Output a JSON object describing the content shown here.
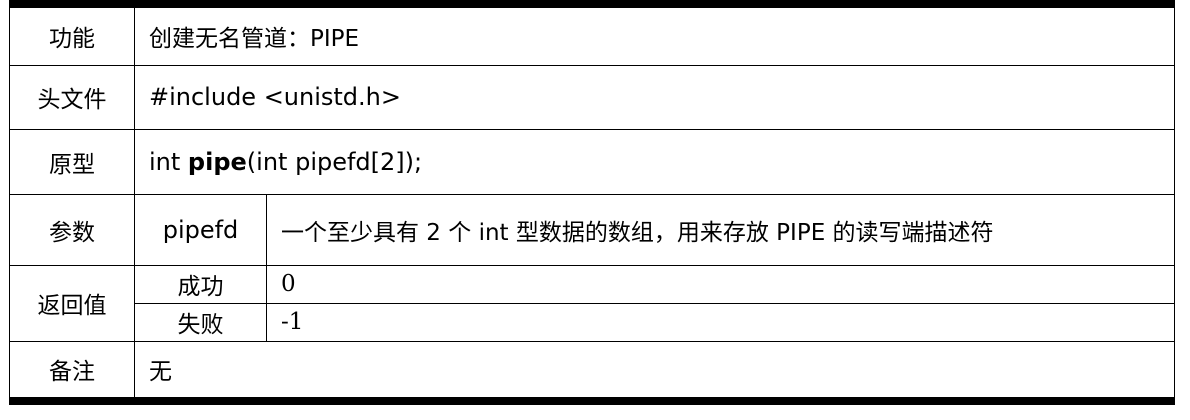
{
  "table": {
    "function": {
      "label": "功能",
      "value": "创建无名管道：PIPE"
    },
    "header_file": {
      "label": "头文件",
      "value": "#include <unistd.h>"
    },
    "prototype": {
      "label": "原型",
      "prefix": "int ",
      "name": "pipe",
      "suffix": "(int pipefd[2]);"
    },
    "params": {
      "label": "参数",
      "name": "pipefd",
      "description": "一个至少具有 2 个 int 型数据的数组，用来存放 PIPE 的读写端描述符"
    },
    "return_value": {
      "label": "返回值",
      "success_label": "成功",
      "success_value": "0",
      "failure_label": "失败",
      "failure_value": "-1"
    },
    "notes": {
      "label": "备注",
      "value": "无"
    }
  }
}
